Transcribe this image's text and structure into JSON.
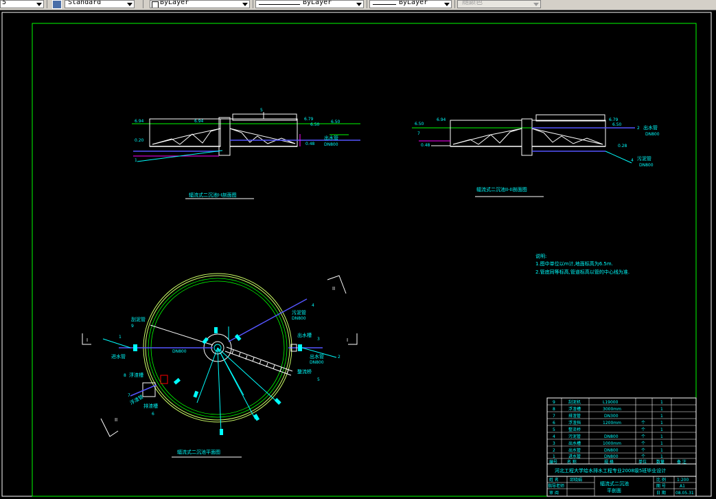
{
  "toolbar": {
    "dim_prefix": "5",
    "text_style": "Standard",
    "layer": "ByLayer",
    "linetype": "ByLayer",
    "lineweight": "ByLayer",
    "color": "随颜色"
  },
  "colors": {
    "border": "#00ff00",
    "text": "#00ffff",
    "structure": "#ffffff",
    "pipe": "#5555ff",
    "accent": "#ff00ff",
    "circle": "#ccff66"
  },
  "section1": {
    "title": "辐流式二沉池I-I剖面图",
    "label_num": "5",
    "lvl_left1": "6.94",
    "lvl_left2": "6.94",
    "lvl_left3": "0.20",
    "lvl_r1": "6.79",
    "lvl_r2": "6.50",
    "lvl_r3": "6.50",
    "lvl_r4": "0.48",
    "pipe_label": "出水管",
    "pipe_dn": "DN800",
    "num1": "1"
  },
  "section2": {
    "title": "辐流式二沉池II-II剖面图",
    "lvl_l1": "6.50",
    "lvl_l2": "6.94",
    "lvl_l3": "0.48",
    "num7": "7",
    "lvl_r1": "6.79",
    "lvl_r2": "6.50",
    "lvl_r3": "0.28",
    "out_label": "出水管",
    "out_dn": "DN800",
    "num2": "2",
    "num4": "4",
    "sludge_label": "污泥管",
    "sludge_dn": "DN800"
  },
  "notes": {
    "title": "说明:",
    "line1": "1.图中单位以m计,地面标高为6.5m.",
    "line2": "2.管底同等标高,管道标高以管的中心线为准."
  },
  "plan": {
    "title": "辐流式二沉池平面图",
    "mark_I": "I",
    "mark_II": "II",
    "scraper_label": "刮泥管",
    "num9": "9",
    "inlet_label": "进水管",
    "inlet_dn": "DN800",
    "sludge_label": "污泥管",
    "sludge_dn": "DN800",
    "outlet_label": "出水槽",
    "num3": "3",
    "outlet_pipe": "出水管",
    "outlet_dn": "DN800",
    "num2": "2",
    "bridge_label": "整流桥",
    "num5": "5",
    "scum_label": "浮渣槽",
    "num8": "8",
    "num7": "7",
    "scum_pipe": "浮渣管",
    "num6": "6",
    "skim_label": "排渣槽",
    "num1": "1",
    "num4": "4"
  },
  "bom": {
    "rows": [
      {
        "no": "9",
        "name": "刮泥机",
        "spec": "L19000",
        "unit": "",
        "qty": "1"
      },
      {
        "no": "8",
        "name": "浮渣槽",
        "spec": "3000mm",
        "unit": "",
        "qty": "1"
      },
      {
        "no": "7",
        "name": "排渣管",
        "spec": "DN300",
        "unit": "",
        "qty": "1"
      },
      {
        "no": "6",
        "name": "浮渣挡",
        "spec": "1200mm",
        "unit": "个",
        "qty": "1"
      },
      {
        "no": "5",
        "name": "整流桥",
        "spec": "",
        "unit": "个",
        "qty": "1"
      },
      {
        "no": "4",
        "name": "污泥管",
        "spec": "DN800",
        "unit": "个",
        "qty": "1"
      },
      {
        "no": "3",
        "name": "出水槽",
        "spec": "1000mm",
        "unit": "个",
        "qty": "1"
      },
      {
        "no": "2",
        "name": "出水管",
        "spec": "DN800",
        "unit": "个",
        "qty": "1"
      },
      {
        "no": "1",
        "name": "进水管",
        "spec": "DN800",
        "unit": "个",
        "qty": "1"
      }
    ],
    "header": {
      "no": "编号",
      "name": "名  称",
      "spec": "规  格",
      "unit": "单位",
      "qty": "数量",
      "note": "备 注"
    },
    "school": "河北工程大学给水排水工程专业2008级5班毕业设计",
    "role1": "姓 名",
    "person1": "邱晓娟",
    "role2": "指导老师",
    "role3": "审 阅",
    "drawing_name1": "辐流式二沉池",
    "drawing_name2": "平剖面",
    "scale_label": "比 例",
    "scale_value": "1:200",
    "sheet_label": "图 号",
    "sheet_value": "A1",
    "date_label": "日 期",
    "date_value": "08.05.31"
  }
}
